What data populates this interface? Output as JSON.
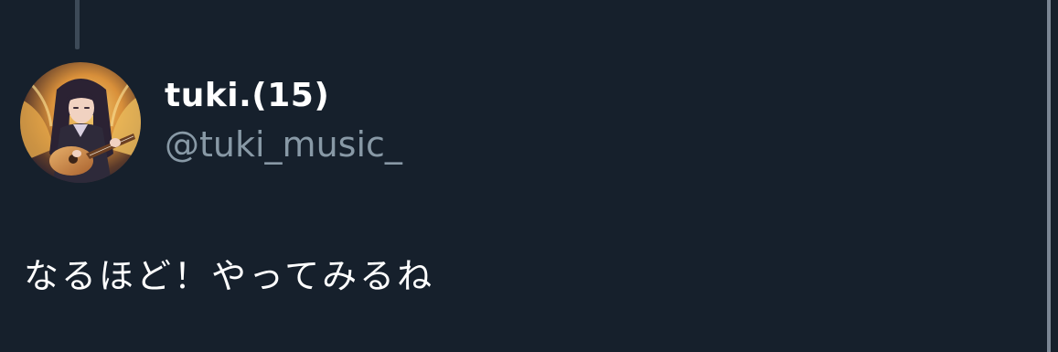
{
  "tweet": {
    "author": {
      "display_name": "tuki.(15)",
      "handle": "@tuki_music_",
      "avatar_icon": "user-avatar-girl-with-guitar"
    },
    "text": "なるほど！やってみるね"
  },
  "colors": {
    "background": "#16202c",
    "primary_text": "#ffffff",
    "secondary_text": "#8899a6",
    "thread_line": "#3d4a58"
  }
}
